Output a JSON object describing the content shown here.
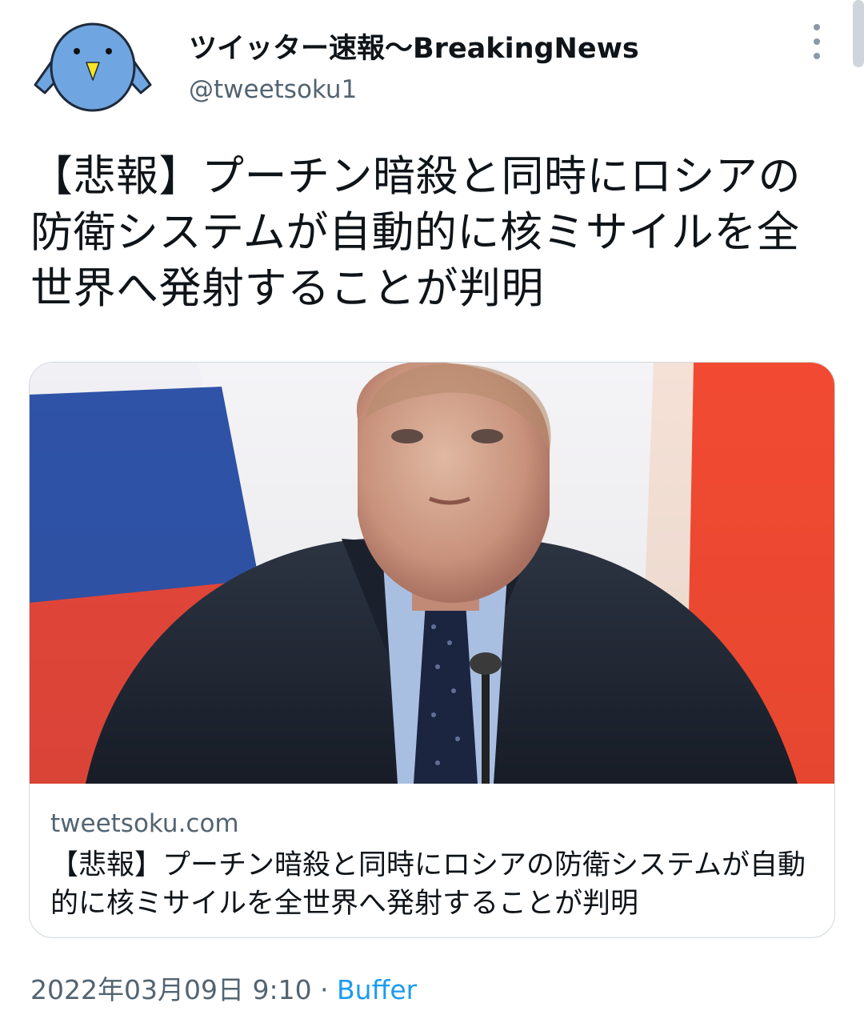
{
  "account": {
    "display_name": "ツイッター速報〜BreakingNews",
    "handle": "@tweetsoku1"
  },
  "tweet": {
    "text": "【悲報】プーチン暗殺と同時にロシアの防衛システムが自動的に核ミサイルを全世界へ発射することが判明"
  },
  "card": {
    "domain": "tweetsoku.com",
    "title": "【悲報】プーチン暗殺と同時にロシアの防衛システムが自動的に核ミサイルを全世界へ発射することが判明"
  },
  "meta": {
    "timestamp": "2022年03月09日 9:10",
    "separator": " · ",
    "source": "Buffer"
  },
  "colors": {
    "text": "#0f1419",
    "secondary": "#536471",
    "link": "#1d9bf0",
    "border": "#cfd9de",
    "avatar_bird": "#6fa5e0"
  },
  "icons": {
    "avatar": "blue-bird-avatar-icon",
    "more": "more-vertical-icon"
  }
}
